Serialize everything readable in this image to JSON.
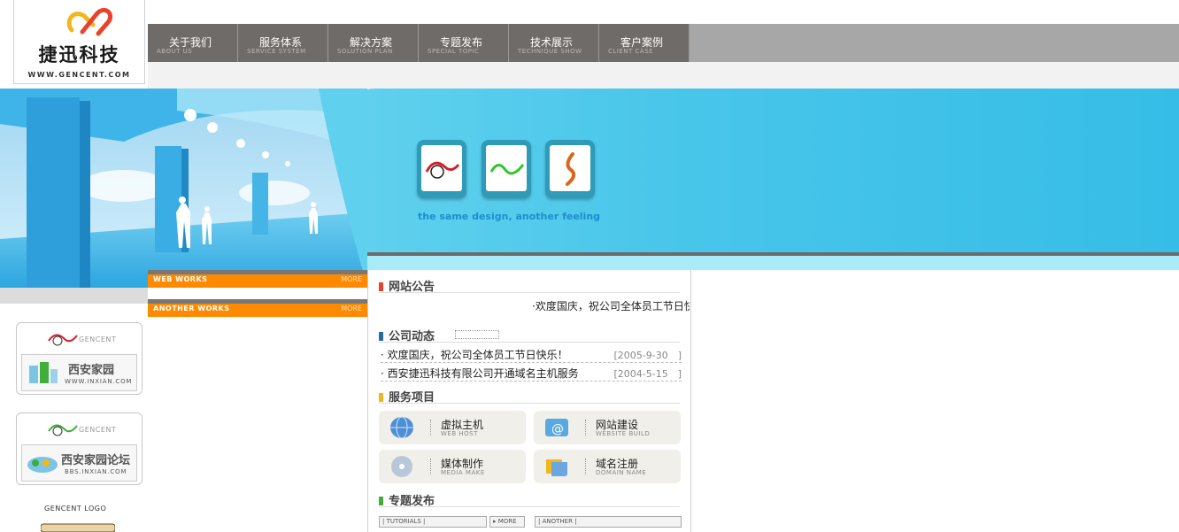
{
  "logo": {
    "cn": "捷迅科技",
    "url": "WWW.GENCENT.COM"
  },
  "nav": [
    {
      "cn": "关于我们",
      "en": "ABOUT US"
    },
    {
      "cn": "服务体系",
      "en": "SERVICE SYSTEM"
    },
    {
      "cn": "解决方案",
      "en": "SOLUTION PLAN"
    },
    {
      "cn": "专题发布",
      "en": "SPECIAL TOPIC"
    },
    {
      "cn": "技术展示",
      "en": "TECHNIQUE SHOW"
    },
    {
      "cn": "客户案例",
      "en": "CLIENT CASE"
    }
  ],
  "banner": {
    "tagline": "the same design, another feeling"
  },
  "works": {
    "web": {
      "label": "WEB WORKS",
      "more": "MORE"
    },
    "another": {
      "label": "ANOTHER WORKS",
      "more": "MORE"
    }
  },
  "promos": [
    {
      "brand": "GENCENT",
      "title": "西安家园",
      "url": "WWW.INXIAN.COM"
    },
    {
      "brand": "GENCENT",
      "title": "西安家园论坛",
      "url": "BBS.INXIAN.COM"
    }
  ],
  "gencent_logo": "GENCENT LOGO",
  "sections": {
    "notice": "网站公告",
    "news": "公司动态",
    "services": "服务项目",
    "topics": "专题发布"
  },
  "notice_marquee": "·欢度国庆，祝公司全体员工节日快",
  "news_items": [
    {
      "title": "· 欢度国庆，祝公司全体员工节日快乐！",
      "date": "[2005-9-30　]"
    },
    {
      "title": "· 西安捷迅科技有限公司开通域名主机服务",
      "date": "[2004-5-15　]"
    }
  ],
  "services": [
    {
      "cn": "虚拟主机",
      "en": "WEB HOST"
    },
    {
      "cn": "网站建设",
      "en": "WEBSITE BUILD"
    },
    {
      "cn": "媒体制作",
      "en": "MEDIA MAKE"
    },
    {
      "cn": "域名注册",
      "en": "DOMAIN NAME"
    }
  ],
  "topic_buttons": {
    "tutorials": "| TUTORIALS |",
    "more": "▸ MORE",
    "another": "| ANOTHER |"
  },
  "colors": {
    "nav_bg": "#6f6b68",
    "accent_orange": "#ff8a00",
    "banner_blue": "#49c6ea"
  }
}
